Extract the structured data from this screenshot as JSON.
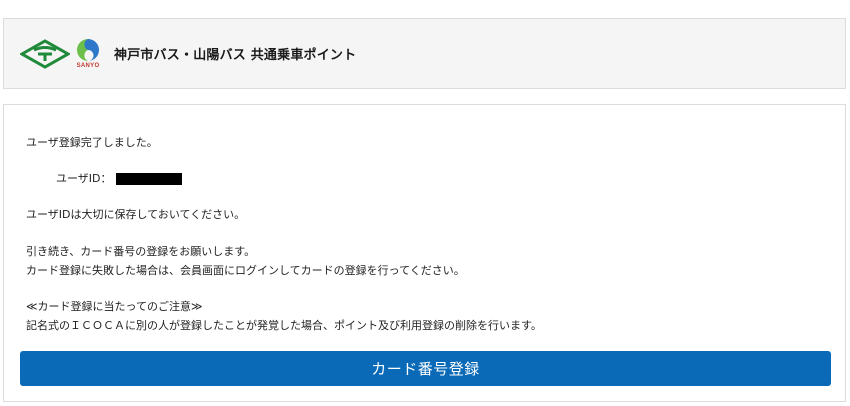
{
  "header": {
    "title": "神戸市バス・山陽バス 共通乗車ポイント",
    "logos": {
      "kobe_city_logo": "kobe-city-emblem",
      "sanyo_logo_text": "SANYO"
    }
  },
  "main": {
    "registration_complete": "ユーザ登録完了しました。",
    "user_id_label": "ユーザID：",
    "keep_id_note": "ユーザIDは大切に保存しておいてください。",
    "continue_note_1": "引き続き、カード番号の登録をお願いします。",
    "continue_note_2": "カード登録に失敗した場合は、会員画面にログインしてカードの登録を行ってください。",
    "caution_heading": "≪カード登録に当たってのご注意≫",
    "caution_text": "記名式のＩＣＯＣＡに別の人が登録したことが発覚した場合、ポイント及び利用登録の削除を行います。",
    "register_button_label": "カード番号登録"
  },
  "colors": {
    "button": "#0a6ab8",
    "header_bg": "#f5f5f5",
    "kobe_green": "#1f8a3a",
    "sanyo_green": "#6cbf4a",
    "sanyo_blue": "#2d78c8"
  }
}
